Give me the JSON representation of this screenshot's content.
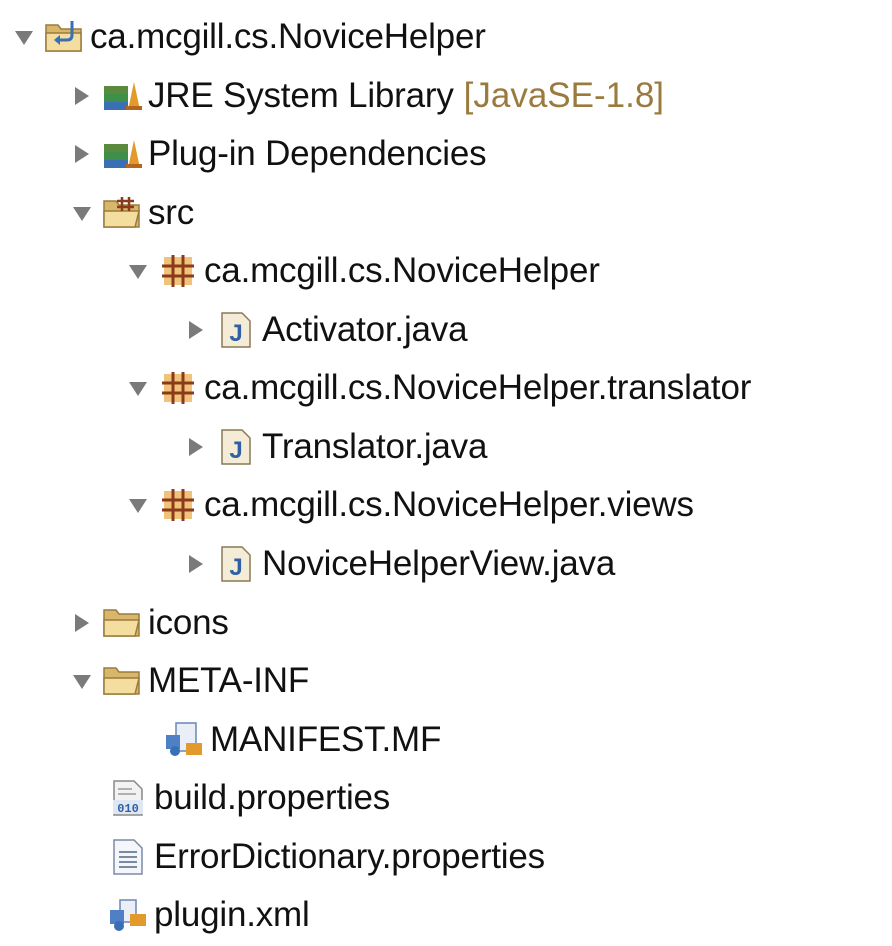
{
  "project": {
    "label": "ca.mcgill.cs.NoviceHelper",
    "icon": "project-folder-icon",
    "expanded": true,
    "children": {
      "jre": {
        "label": "JRE System Library",
        "decoration": "[JavaSE-1.8]",
        "icon": "library-icon",
        "expanded": false
      },
      "plugin_deps": {
        "label": "Plug-in Dependencies",
        "icon": "library-icon",
        "expanded": false
      },
      "src": {
        "label": "src",
        "icon": "source-folder-icon",
        "expanded": true,
        "packages": [
          {
            "label": "ca.mcgill.cs.NoviceHelper",
            "icon": "package-icon",
            "expanded": true,
            "file": {
              "label": "Activator.java",
              "icon": "java-file-icon"
            }
          },
          {
            "label": "ca.mcgill.cs.NoviceHelper.translator",
            "icon": "package-icon",
            "expanded": true,
            "file": {
              "label": "Translator.java",
              "icon": "java-file-icon"
            }
          },
          {
            "label": "ca.mcgill.cs.NoviceHelper.views",
            "icon": "package-icon",
            "expanded": true,
            "file": {
              "label": "NoviceHelperView.java",
              "icon": "java-file-icon"
            }
          }
        ]
      },
      "icons_folder": {
        "label": "icons",
        "icon": "folder-icon",
        "expanded": false
      },
      "meta_inf": {
        "label": "META-INF",
        "icon": "folder-icon",
        "expanded": true,
        "file": {
          "label": "MANIFEST.MF",
          "icon": "manifest-icon"
        }
      },
      "build_properties": {
        "label": "build.properties",
        "icon": "binary-properties-icon"
      },
      "error_dictionary": {
        "label": "ErrorDictionary.properties",
        "icon": "text-file-icon"
      },
      "plugin_xml": {
        "label": "plugin.xml",
        "icon": "plugin-xml-icon"
      }
    }
  },
  "colors": {
    "twistie": "#7a7a7a",
    "decoration": "#9a7b3d",
    "text": "#111111"
  }
}
